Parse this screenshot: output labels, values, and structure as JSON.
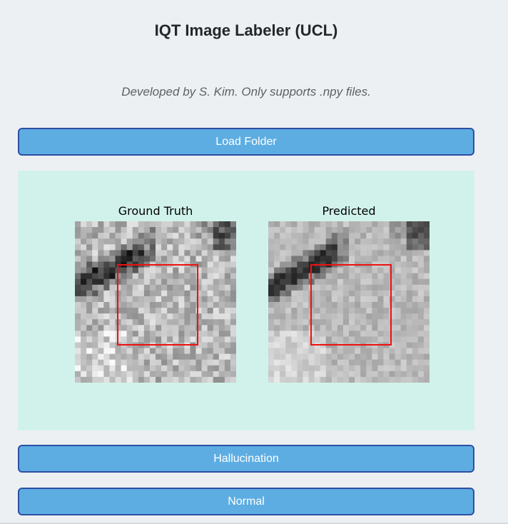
{
  "header": {
    "title": "IQT Image Labeler (UCL)",
    "subtitle": "Developed by S. Kim. Only supports .npy files."
  },
  "toolbar": {
    "load_label": "Load Folder"
  },
  "viewer": {
    "ground_truth_label": "Ground Truth",
    "predicted_label": "Predicted"
  },
  "actions": {
    "hallucination_label": "Hallucination",
    "normal_label": "Normal"
  },
  "colors": {
    "button_bg": "#5dade2",
    "button_border": "#2e4fa3",
    "panel_bg": "#d1f2eb",
    "roi_box": "#ee1111",
    "page_bg": "#edf0f2"
  }
}
